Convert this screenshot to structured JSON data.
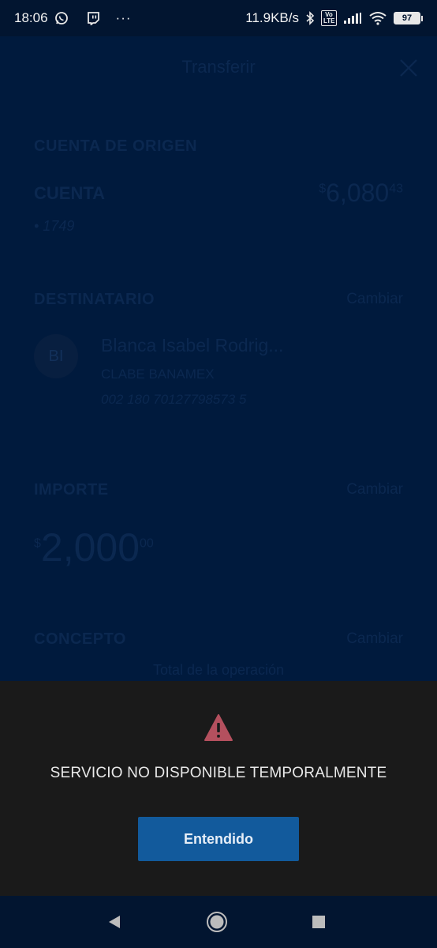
{
  "status_bar": {
    "time": "18:06",
    "more": "···",
    "net_speed": "11.9KB/s",
    "volte": "Vo LTE",
    "battery": "97"
  },
  "screen": {
    "title": "Transferir",
    "origin": {
      "section_title": "CUENTA DE ORIGEN",
      "account_name": "CUENTA",
      "balance_symbol": "$",
      "balance_main": "6,080",
      "balance_cents": "43",
      "account_mask": "• 1749"
    },
    "recipient": {
      "section_title": "DESTINATARIO",
      "change_label": "Cambiar",
      "initials": "BI",
      "name": "Blanca Isabel Rodrig...",
      "bank": "CLABE BANAMEX",
      "clabe": "002 180 70127798573 5"
    },
    "amount": {
      "section_title": "IMPORTE",
      "change_label": "Cambiar",
      "symbol": "$",
      "main": "2,000",
      "cents": "00"
    },
    "concept": {
      "section_title": "CONCEPTO",
      "change_label": "Cambiar"
    },
    "total_label": "Total de la operación"
  },
  "dialog": {
    "icon": "warning-triangle-icon",
    "message": "SERVICIO NO DISPONIBLE TEMPORALMENTE",
    "button_label": "Entendido",
    "icon_color": "#b4505e",
    "button_color": "#125a9c"
  },
  "nav": {
    "back": "back-triangle-icon",
    "home": "home-circle-icon",
    "recents": "recents-square-icon"
  }
}
